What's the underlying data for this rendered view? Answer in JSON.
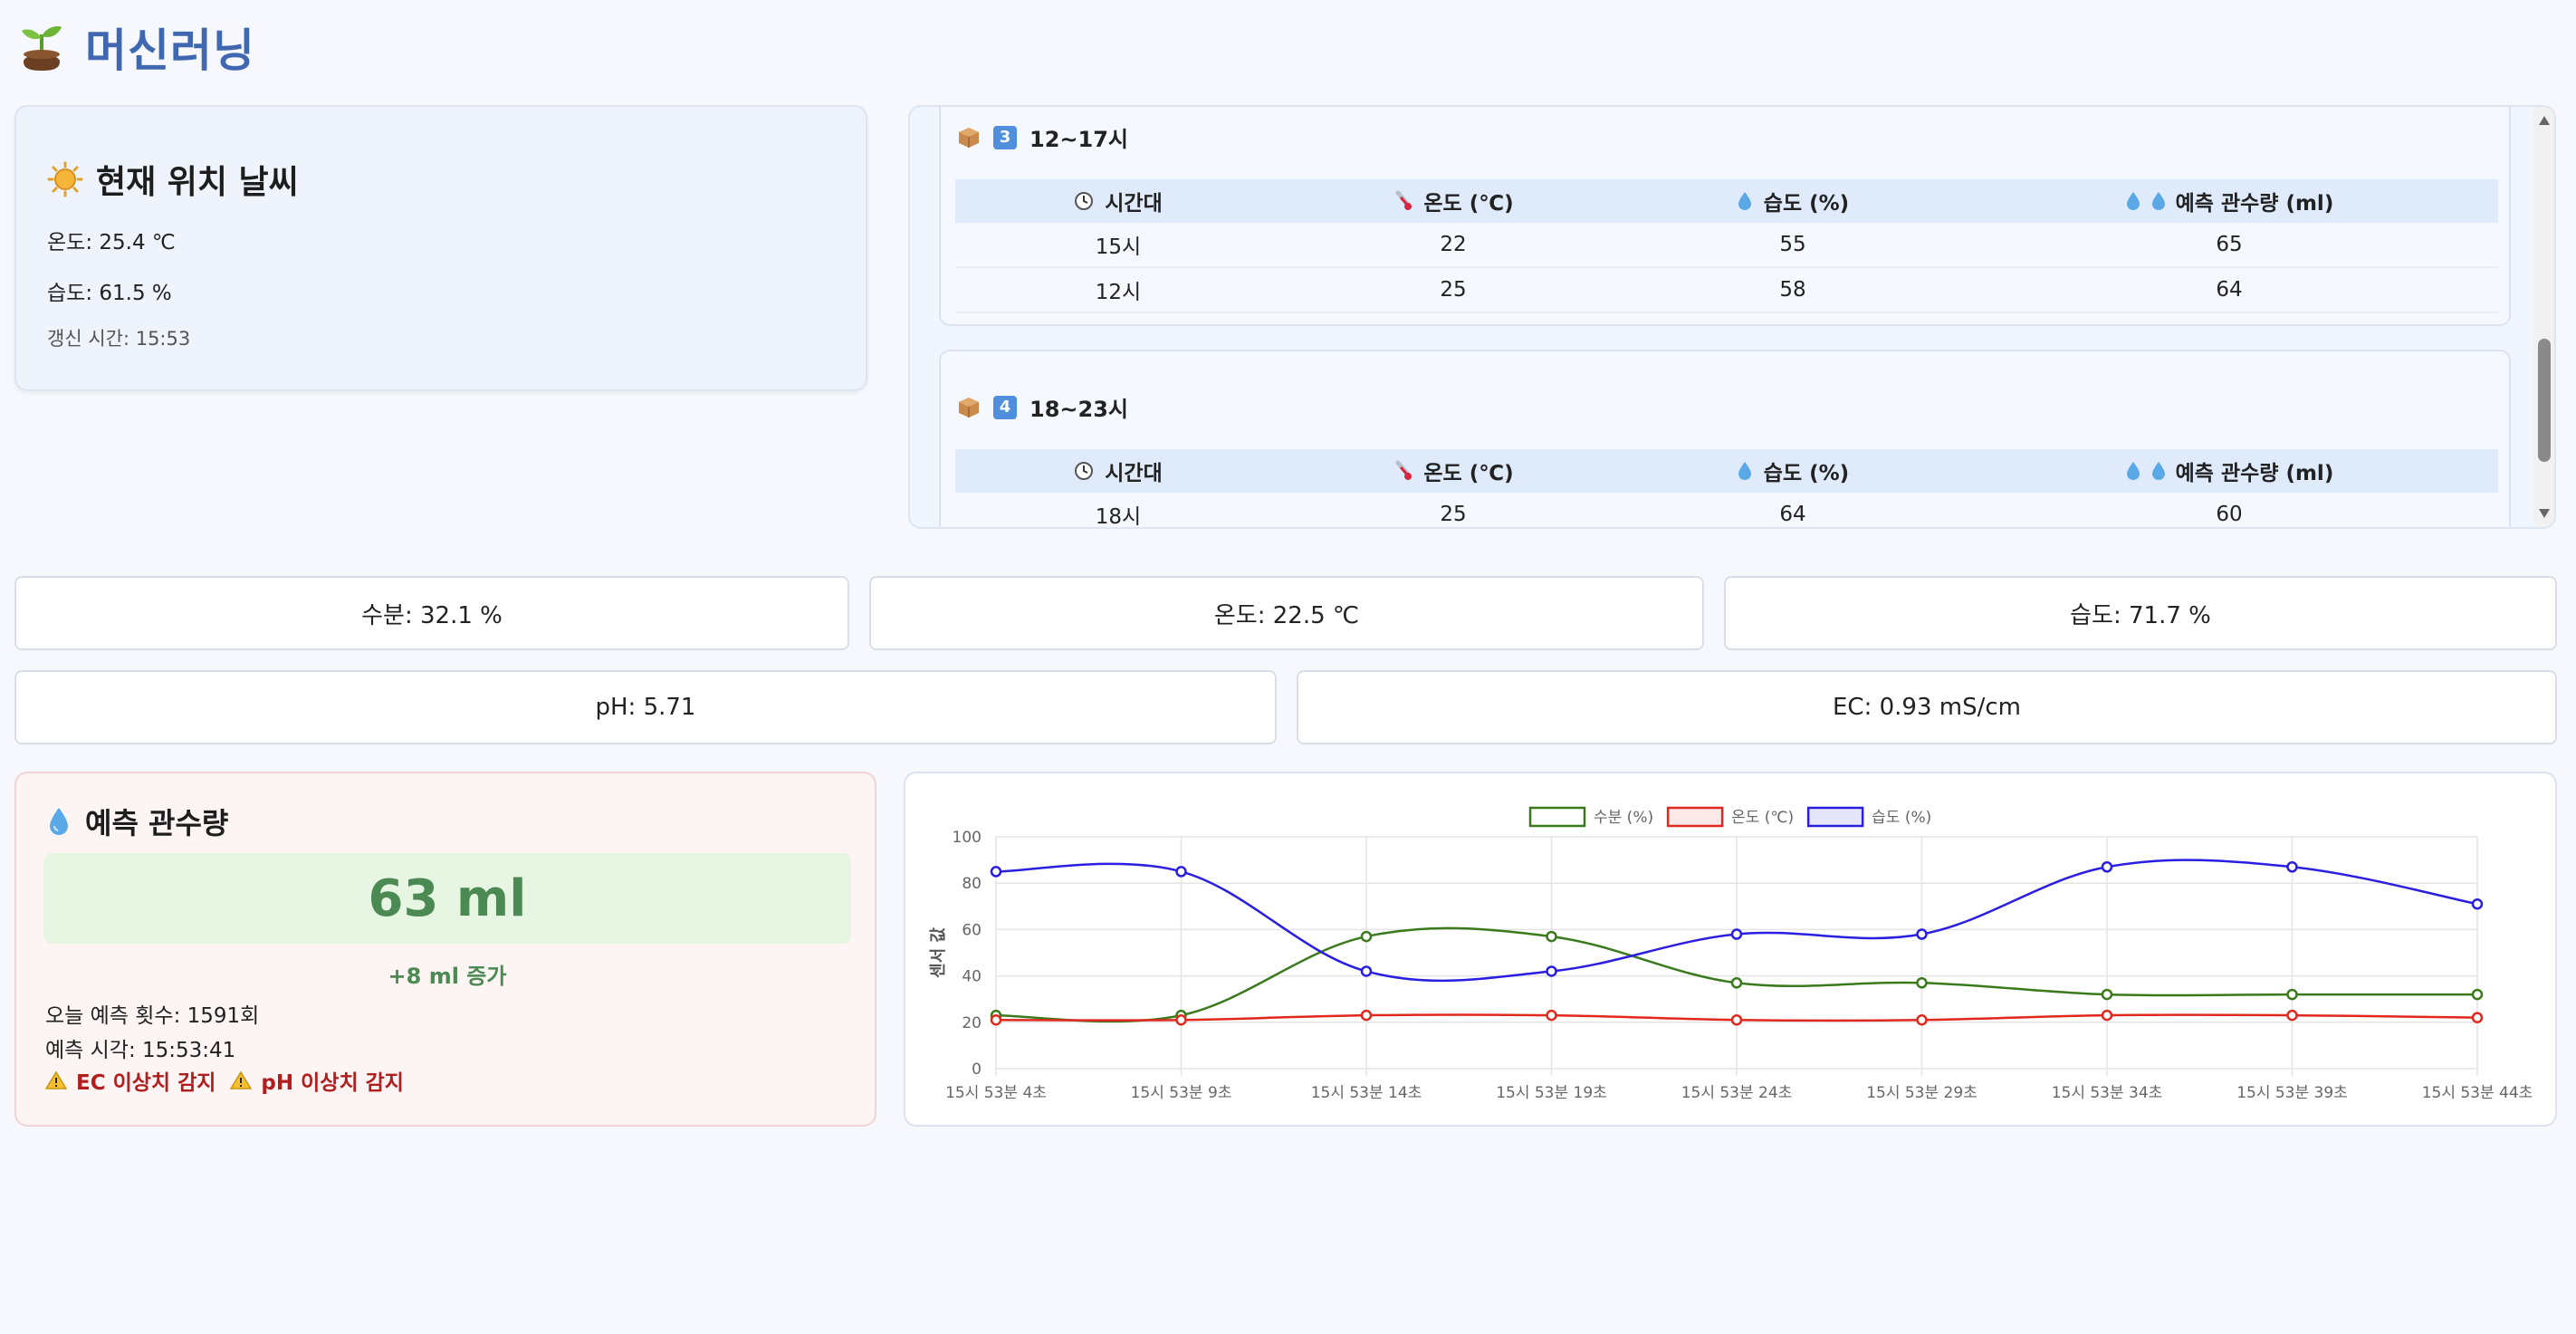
{
  "app": {
    "title": "머신러닝"
  },
  "weather": {
    "title": "현재 위치 날씨",
    "temperature": "온도: 25.4 ℃",
    "humidity": "습도: 61.5 %",
    "updated": "갱신 시간: 15:53"
  },
  "forecast": {
    "columns": [
      "시간대",
      "온도 (℃)",
      "습도 (%)",
      "예측 관수량 (ml)"
    ],
    "blocks": [
      {
        "number": "3",
        "label": "12~17시",
        "rows": [
          {
            "time": "15시",
            "temp": "22",
            "humidity": "55",
            "water": "65"
          },
          {
            "time": "12시",
            "temp": "25",
            "humidity": "58",
            "water": "64"
          }
        ]
      },
      {
        "number": "4",
        "label": "18~23시",
        "rows": [
          {
            "time": "18시",
            "temp": "25",
            "humidity": "64",
            "water": "60"
          }
        ]
      }
    ]
  },
  "sensors": {
    "moisture": "수분: 32.1 %",
    "temperature": "온도: 22.5 ℃",
    "humidity": "습도: 71.7 %",
    "ph": "pH: 5.71",
    "ec": "EC: 0.93 mS/cm"
  },
  "prediction": {
    "title": "예측 관수량",
    "value": "63 ml",
    "delta": "+8 ml 증가",
    "count": "오늘 예측 횟수: 1591회",
    "time": "예측 시각: 15:53:41",
    "alert_ec": "EC 이상치 감지",
    "alert_ph": "pH 이상치 감지"
  },
  "colors": {
    "moisture": "#3a7a1c",
    "temperature": "#e0281e",
    "humidity": "#2a1ee0",
    "title": "#3f68b0"
  },
  "chart_data": {
    "type": "line",
    "title": "",
    "xlabel": "",
    "ylabel": "센서 값",
    "ylim": [
      0,
      100
    ],
    "yticks": [
      0,
      20,
      40,
      60,
      80,
      100
    ],
    "grid": true,
    "legend_position": "top",
    "categories": [
      "15시 53분 4초",
      "15시 53분 9초",
      "15시 53분 14초",
      "15시 53분 19초",
      "15시 53분 24초",
      "15시 53분 29초",
      "15시 53분 34초",
      "15시 53분 39초",
      "15시 53분 44초"
    ],
    "series": [
      {
        "name": "수분 (%)",
        "color": "#3a7a1c",
        "values": [
          23,
          23,
          57,
          57,
          37,
          37,
          32,
          32,
          32
        ]
      },
      {
        "name": "온도 (℃)",
        "color": "#e0281e",
        "values": [
          21,
          21,
          23,
          23,
          21,
          21,
          23,
          23,
          22
        ]
      },
      {
        "name": "습도 (%)",
        "color": "#2a1ee0",
        "values": [
          85,
          85,
          42,
          42,
          58,
          58,
          87,
          87,
          71
        ]
      }
    ]
  }
}
